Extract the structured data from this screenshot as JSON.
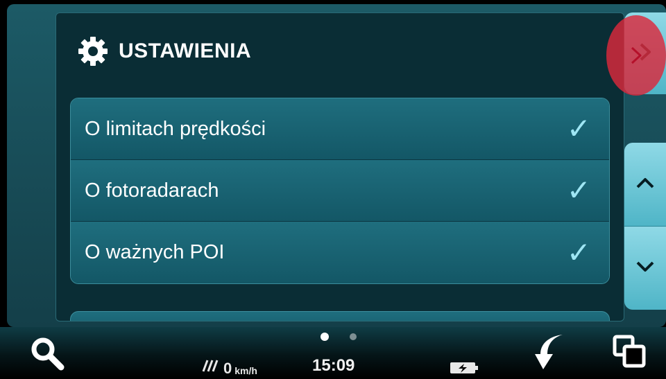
{
  "settings": {
    "title": "USTAWIENIA",
    "items": [
      {
        "label": "O limitach prędkości",
        "checked": true
      },
      {
        "label": "O fotoradarach",
        "checked": true
      },
      {
        "label": "O ważnych POI",
        "checked": true
      }
    ],
    "check_glyph": "✓"
  },
  "side_buttons": {
    "next": "chevron-right-icon",
    "up": "chevron-up-icon",
    "down": "chevron-down-icon"
  },
  "status": {
    "speed_value": "0",
    "speed_unit": "km/h",
    "time": "15:09",
    "page_count": 2,
    "active_page": 1
  },
  "colors": {
    "accent": "#4fb5c7",
    "highlight": "#dc283c",
    "check": "#9fe6f4"
  }
}
